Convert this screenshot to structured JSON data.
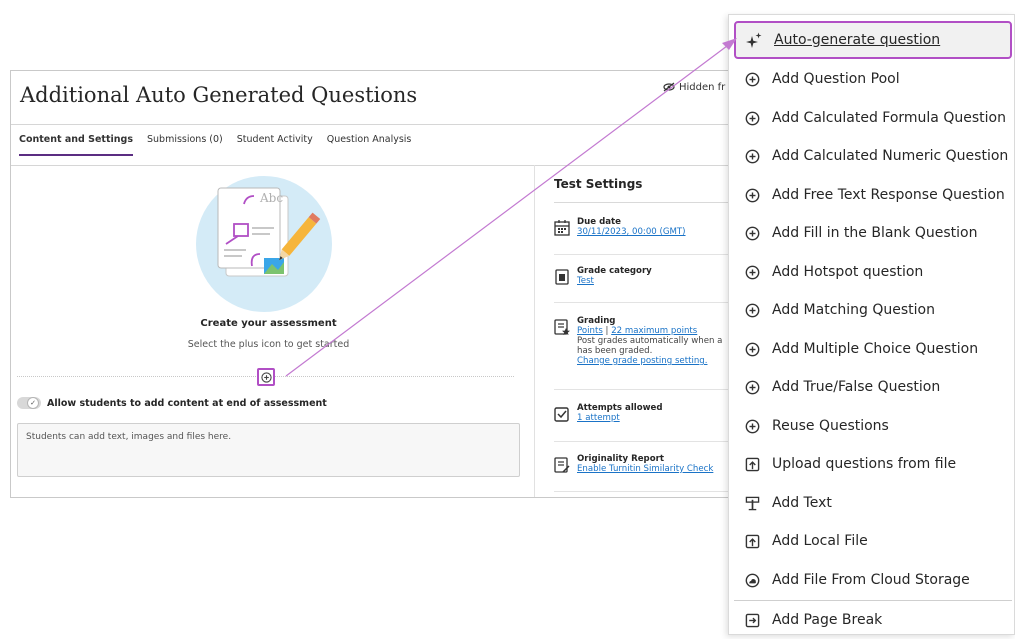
{
  "page": {
    "title": "Additional Auto Generated Questions",
    "hidden_badge": "Hidden fr"
  },
  "tabs": [
    {
      "label": "Content and Settings",
      "active": true
    },
    {
      "label": "Submissions (0)"
    },
    {
      "label": "Student Activity"
    },
    {
      "label": "Question Analysis"
    }
  ],
  "main": {
    "create_title": "Create your assessment",
    "create_subtitle": "Select the plus icon to get started",
    "illustration_text": "Abc",
    "allow_label": "Allow students to add content at end of assessment",
    "students_placeholder": "Students can add text, images and files here."
  },
  "test_settings": {
    "title": "Test Settings",
    "due": {
      "title": "Due date",
      "value": "30/11/2023, 00:00 (GMT)"
    },
    "grade_category": {
      "title": "Grade category",
      "value": "Test"
    },
    "grading": {
      "title": "Grading",
      "link1": "Points",
      "sep": " | ",
      "link2": "22 maximum points",
      "line1": "Post grades automatically when a",
      "line2": "has been graded.",
      "link3": "Change grade posting setting."
    },
    "attempts": {
      "title": "Attempts allowed",
      "value": "1 attempt"
    },
    "originality": {
      "title": "Originality Report",
      "value": "Enable Turnitin Similarity Check"
    }
  },
  "menu": {
    "items": [
      {
        "label": "Auto-generate question",
        "icon": "sparkle-icon",
        "highlighted": true
      },
      {
        "label": "Add Question Pool",
        "icon": "plus-circle-icon"
      },
      {
        "label": "Add Calculated Formula Question",
        "icon": "plus-circle-icon"
      },
      {
        "label": "Add Calculated Numeric Question",
        "icon": "plus-circle-icon"
      },
      {
        "label": "Add Free Text Response Question",
        "icon": "plus-circle-icon"
      },
      {
        "label": "Add Fill in the Blank Question",
        "icon": "plus-circle-icon"
      },
      {
        "label": "Add Hotspot question",
        "icon": "plus-circle-icon"
      },
      {
        "label": "Add Matching Question",
        "icon": "plus-circle-icon"
      },
      {
        "label": "Add Multiple Choice Question",
        "icon": "plus-circle-icon"
      },
      {
        "label": "Add True/False Question",
        "icon": "plus-circle-icon"
      },
      {
        "label": "Reuse Questions",
        "icon": "plus-circle-icon"
      },
      {
        "label": "Upload questions from file",
        "icon": "upload-file-icon"
      },
      {
        "label": "Add Text",
        "icon": "text-icon"
      },
      {
        "label": "Add Local File",
        "icon": "upload-file-icon"
      },
      {
        "label": "Add File From Cloud Storage",
        "icon": "cloud-icon"
      },
      {
        "label": "Add Page Break",
        "icon": "page-break-icon"
      }
    ]
  },
  "colors": {
    "accent": "#b14fc5",
    "tab_active": "#5b2d82",
    "link": "#1a73c7"
  }
}
